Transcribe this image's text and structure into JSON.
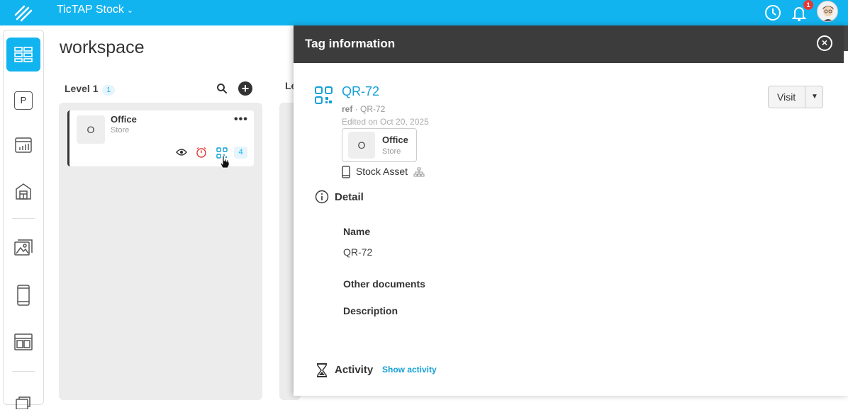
{
  "app": {
    "title": "TicTAP Stock",
    "notification_count": "1"
  },
  "sidebar": {
    "items": [
      {
        "icon": "levels-icon",
        "active": true
      },
      {
        "icon": "parking-icon",
        "label": "P"
      },
      {
        "icon": "chart-icon"
      },
      {
        "icon": "warehouse-icon"
      },
      {
        "icon": "gallery-icon"
      },
      {
        "icon": "device-icon"
      },
      {
        "icon": "layout-icon"
      },
      {
        "icon": "documents-icon"
      }
    ]
  },
  "workspace": {
    "title": "workspace",
    "level1": {
      "label": "Level 1",
      "count": "1"
    },
    "level2": {
      "label": "Le"
    },
    "card": {
      "thumb": "O",
      "name": "Office",
      "type": "Store",
      "tag_count": "4"
    }
  },
  "panel": {
    "title": "Tag information",
    "tag": {
      "name": "QR-72",
      "ref_label": "ref",
      "ref_value": "QR-72",
      "edited": "Edited on Oct 20, 2025",
      "location": {
        "thumb": "O",
        "name": "Office",
        "type": "Store"
      },
      "asset": "Stock Asset"
    },
    "visit_label": "Visit",
    "detail": {
      "title": "Detail",
      "name_label": "Name",
      "name_value": "QR-72",
      "other_docs_label": "Other documents",
      "description_label": "Description"
    },
    "activity": {
      "title": "Activity",
      "show_label": "Show activity"
    }
  },
  "colors": {
    "accent": "#12b4f0",
    "link": "#12a0d8",
    "header": "#3c3c3c",
    "alert": "#e53935"
  }
}
